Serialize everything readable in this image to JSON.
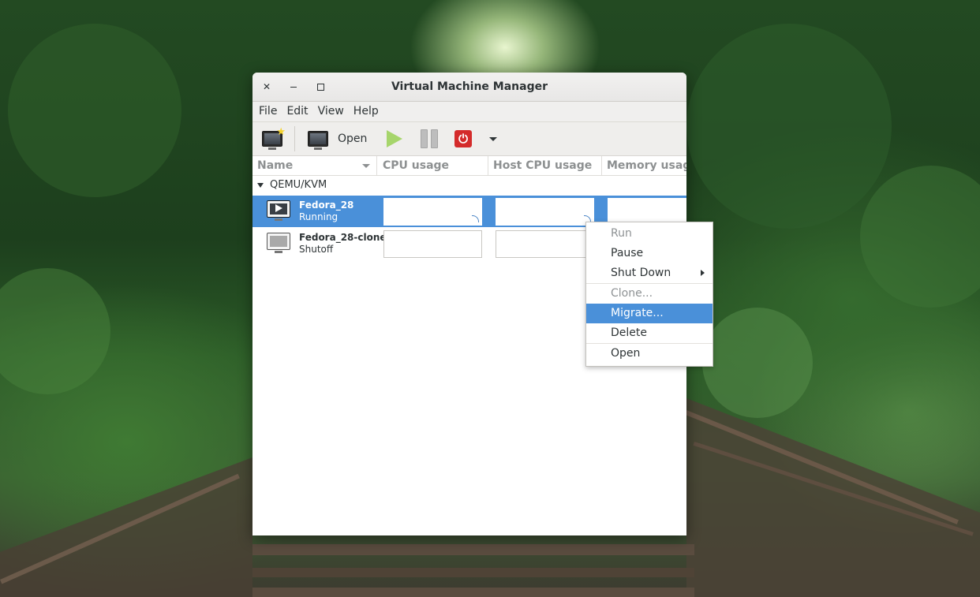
{
  "window": {
    "title": "Virtual Machine Manager"
  },
  "menubar": [
    "File",
    "Edit",
    "View",
    "Help"
  ],
  "toolbar": {
    "new_vm_icon": "new-vm-icon",
    "open_label": "Open",
    "run_icon": "play-icon",
    "pause_icon": "pause-icon",
    "shutdown_icon": "power-icon",
    "more_icon": "chevron-down-icon"
  },
  "columns": [
    "Name",
    "CPU usage",
    "Host CPU usage",
    "Memory usage"
  ],
  "connection": {
    "label": "QEMU/KVM"
  },
  "vms": [
    {
      "name": "Fedora_28",
      "state": "Running",
      "icon": "vm-running-icon"
    },
    {
      "name": "Fedora_28-clone",
      "state": "Shutoff",
      "icon": "vm-shutoff-icon"
    }
  ],
  "context_menu": {
    "run": "Run",
    "pause": "Pause",
    "shutdown": "Shut Down",
    "clone": "Clone...",
    "migrate": "Migrate...",
    "delete": "Delete",
    "open": "Open"
  },
  "colors": {
    "selection": "#4a90d9",
    "disabled_text": "#8e9294",
    "power_red": "#d42b2b",
    "run_green": "#a6d56b"
  }
}
